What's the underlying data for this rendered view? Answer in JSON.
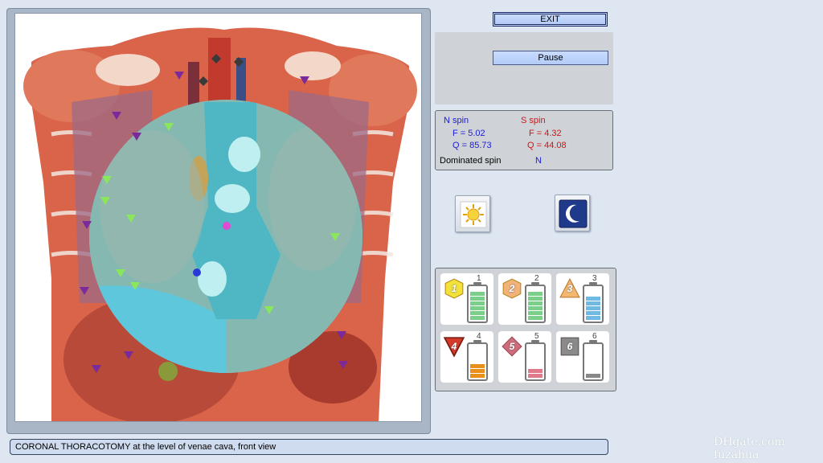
{
  "buttons": {
    "exit_label": "EXIT",
    "pause_label": "Pause"
  },
  "spin": {
    "n_header": "N spin",
    "n_f": "F =  5.02",
    "n_q": "Q = 85.73",
    "s_header": "S spin",
    "s_f": "F =  4.32",
    "s_q": "Q = 44.08",
    "dominated_label": "Dominated spin",
    "dominated_value": "N"
  },
  "modes": {
    "day_icon": "sun-icon",
    "night_icon": "moon-icon"
  },
  "stages": [
    {
      "num": "1",
      "badge": "1",
      "shape": "hexagon",
      "color": "#f2e23a",
      "level": 1.0,
      "fill_color": "#7ccf8a"
    },
    {
      "num": "2",
      "badge": "2",
      "shape": "hexagon",
      "color": "#f2b27a",
      "level": 1.0,
      "fill_color": "#7ccf8a"
    },
    {
      "num": "3",
      "badge": "3",
      "shape": "triangle-up",
      "color": "#f3b870",
      "level": 0.8,
      "fill_color": "#6fb9e3"
    },
    {
      "num": "4",
      "badge": "4",
      "shape": "triangle-down",
      "color": "#d43a2a",
      "level": 0.5,
      "fill_color": "#e8901a"
    },
    {
      "num": "5",
      "badge": "5",
      "shape": "diamond",
      "color": "#cf6b7a",
      "level": 0.35,
      "fill_color": "#e07a8a"
    },
    {
      "num": "6",
      "badge": "6",
      "shape": "square",
      "color": "#8a8a8a",
      "level": 0.15,
      "fill_color": "#888888"
    }
  ],
  "status": {
    "caption": "CORONAL THORACOTOMY at the level of venae cava, front view"
  },
  "watermark": {
    "text": "DHgate.com  fuzahua"
  }
}
